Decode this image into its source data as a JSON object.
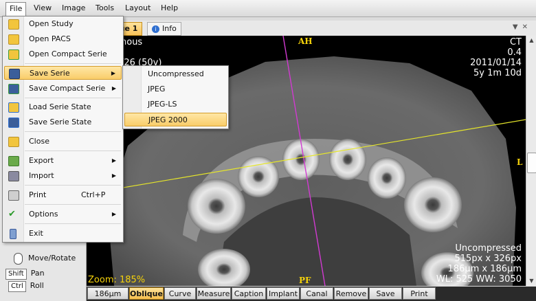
{
  "menubar": {
    "items": [
      "File",
      "View",
      "Image",
      "Tools",
      "Layout",
      "Help"
    ]
  },
  "tabs": {
    "active": "Oblique 1",
    "info": "Info"
  },
  "file_menu": {
    "items": [
      {
        "label": "Open Study",
        "icon": "folder-icon"
      },
      {
        "label": "Open PACS",
        "icon": "folder-network-icon"
      },
      {
        "label": "Open Compact Serie",
        "icon": "folder-compact-icon"
      },
      {
        "label": "Save Serie",
        "icon": "save-icon"
      },
      {
        "label": "Save Compact Serie",
        "icon": "save-compact-icon"
      },
      {
        "label": "Load Serie State",
        "icon": "folder-load-icon"
      },
      {
        "label": "Save Serie State",
        "icon": "save-state-icon"
      },
      {
        "label": "Close",
        "icon": "folder-close-icon"
      },
      {
        "label": "Export",
        "icon": "export-icon"
      },
      {
        "label": "Import",
        "icon": "import-icon"
      },
      {
        "label": "Print",
        "icon": "printer-icon",
        "shortcut": "Ctrl+P"
      },
      {
        "label": "Options",
        "icon": "checkmark-icon"
      },
      {
        "label": "Exit",
        "icon": "exit-icon"
      }
    ]
  },
  "save_serie_submenu": {
    "items": [
      "Uncompressed",
      "JPEG",
      "JPEG-LS",
      "JPEG 2000"
    ]
  },
  "viewer": {
    "patient_name_partial": "nous",
    "patient_dob_partial": "/26 (50y)",
    "modality": "CT",
    "value": "0.4",
    "date": "2011/01/14",
    "age": "5y 1m 10d",
    "top_marker": "AH",
    "bottom_marker": "PF",
    "right_marker": "L",
    "zoom": "Zoom: 185%",
    "compression": "Uncompressed",
    "size_px": "515px x 326px",
    "size_um": "186µm x 186µm",
    "window": "WL: 525 WW: 3050"
  },
  "left_panel": {
    "move_label": "Move/Rotate",
    "shift_key": "Shift",
    "pan": "Pan",
    "ctrl_key": "Ctrl",
    "roll": "Roll"
  },
  "toolbar": {
    "items": [
      "186µm",
      "Oblique",
      "Curve",
      "Measure",
      "Caption",
      "Implant",
      "Canal",
      "Remove",
      "Save",
      "Print"
    ],
    "active": "Oblique"
  },
  "colors": {
    "menu_highlight": "#f9cd6a",
    "overlay_yellow": "#f5d20a",
    "magenta_line": "#d23ad2",
    "yellow_line": "#e6e62a"
  }
}
